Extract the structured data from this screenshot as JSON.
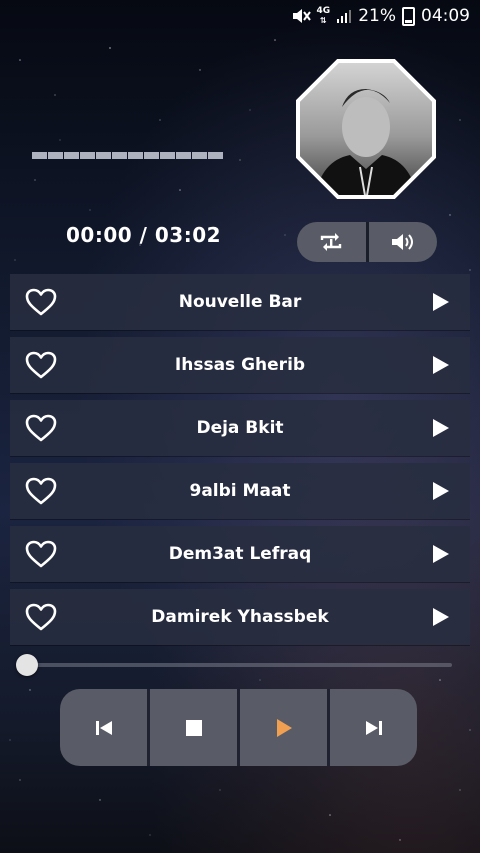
{
  "status_bar": {
    "network": "4G",
    "battery": "21%",
    "time": "04:09"
  },
  "player": {
    "time_display": "00:00 / 03:02",
    "seek_progress": 0.0,
    "visualizer_bars": 12
  },
  "songs": [
    {
      "title": "Nouvelle Bar"
    },
    {
      "title": "Ihssas Gherib"
    },
    {
      "title": "Deja Bkit"
    },
    {
      "title": "9albi Maat"
    },
    {
      "title": "Dem3at Lefraq"
    },
    {
      "title": "Damirek Yhassbek"
    }
  ],
  "icons": {
    "status": [
      "mute-icon",
      "network-4g-icon",
      "signal-icon",
      "battery-icon"
    ],
    "controls": [
      "repeat-icon",
      "volume-icon"
    ],
    "transport": [
      "previous-icon",
      "stop-icon",
      "play-icon",
      "next-icon"
    ],
    "row": [
      "heart-icon",
      "play-icon"
    ]
  },
  "colors": {
    "accent": "#f0a050",
    "row_bg": "#282e40",
    "control_bg": "#595c66"
  }
}
